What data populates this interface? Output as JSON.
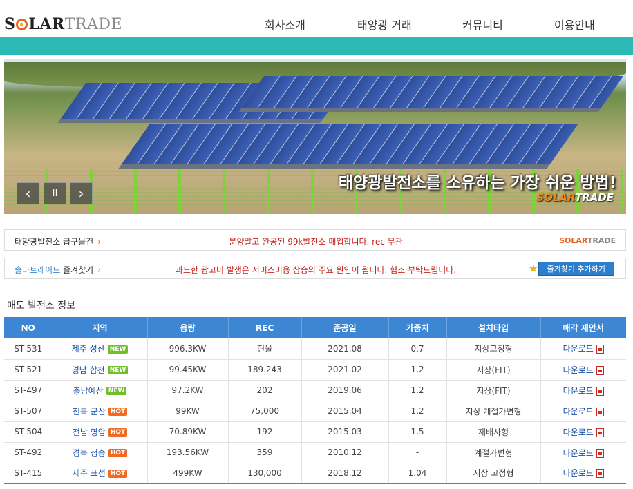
{
  "brand": {
    "solar_pre": "S",
    "solar_post": "LAR",
    "trade": "TRADE"
  },
  "nav": [
    {
      "label": "회사소개"
    },
    {
      "label": "태양광 거래"
    },
    {
      "label": "커뮤니티"
    },
    {
      "label": "이용안내"
    }
  ],
  "banner": {
    "caption": "태양광발전소를 소유하는 가장 쉬운 방법!",
    "brand_solar": "SOLAR",
    "brand_trade": "TRADE",
    "controls": {
      "prev": "‹",
      "pause": "II",
      "next": "›"
    }
  },
  "urgent": {
    "label": "태양광발전소 급구물건",
    "arrow": "›",
    "message": "분양말고 완공된 99k발전소 매입합니다. rec 무관",
    "logo_solar": "SOLAR",
    "logo_trade": "TRADE"
  },
  "favorites": {
    "label_link": "솔라트레이드",
    "label_rest": " 즐겨찾기",
    "arrow": "›",
    "message": "과도한 광고비 발생은 서비스비용 상승의 주요 원인이 됩니다. 협조 부탁드립니다.",
    "button": "즐겨찾기 추가하기"
  },
  "section_title": "매도 발전소 정보",
  "table": {
    "headers": [
      "NO",
      "지역",
      "용량",
      "REC",
      "준공일",
      "가중치",
      "설치타입",
      "매각 제안서"
    ],
    "rows": [
      {
        "no": "ST-531",
        "region": "제주 성산",
        "badge": "NEW",
        "capacity": "996.3KW",
        "rec": "현물",
        "date": "2021.08",
        "weight": "0.7",
        "type": "지상고정형",
        "download": "다운로드"
      },
      {
        "no": "ST-521",
        "region": "경남 합천",
        "badge": "NEW",
        "capacity": "99.45KW",
        "rec": "189.243",
        "date": "2021.02",
        "weight": "1.2",
        "type": "지상(FIT)",
        "download": "다운로드"
      },
      {
        "no": "ST-497",
        "region": "충남예산",
        "badge": "NEW",
        "capacity": "97.2KW",
        "rec": "202",
        "date": "2019.06",
        "weight": "1.2",
        "type": "지상(FIT)",
        "download": "다운로드"
      },
      {
        "no": "ST-507",
        "region": "전북 군산",
        "badge": "HOT",
        "capacity": "99KW",
        "rec": "75,000",
        "date": "2015.04",
        "weight": "1.2",
        "type": "지상 계절가변형",
        "download": "다운로드"
      },
      {
        "no": "ST-504",
        "region": "전남 영암",
        "badge": "HOT",
        "capacity": "70.89KW",
        "rec": "192",
        "date": "2015.03",
        "weight": "1.5",
        "type": "재배사형",
        "download": "다운로드"
      },
      {
        "no": "ST-492",
        "region": "경북 청송",
        "badge": "HOT",
        "capacity": "193.56KW",
        "rec": "359",
        "date": "2010.12",
        "weight": "-",
        "type": "계절가변형",
        "download": "다운로드"
      },
      {
        "no": "ST-415",
        "region": "제주 표선",
        "badge": "HOT",
        "capacity": "499KW",
        "rec": "130,000",
        "date": "2018.12",
        "weight": "1.04",
        "type": "지상 고정형",
        "download": "다운로드"
      }
    ]
  },
  "colors": {
    "accent_teal": "#2bbab5",
    "header_blue": "#3c86d4",
    "alert_red": "#c7231e",
    "orange": "#e8641a"
  }
}
